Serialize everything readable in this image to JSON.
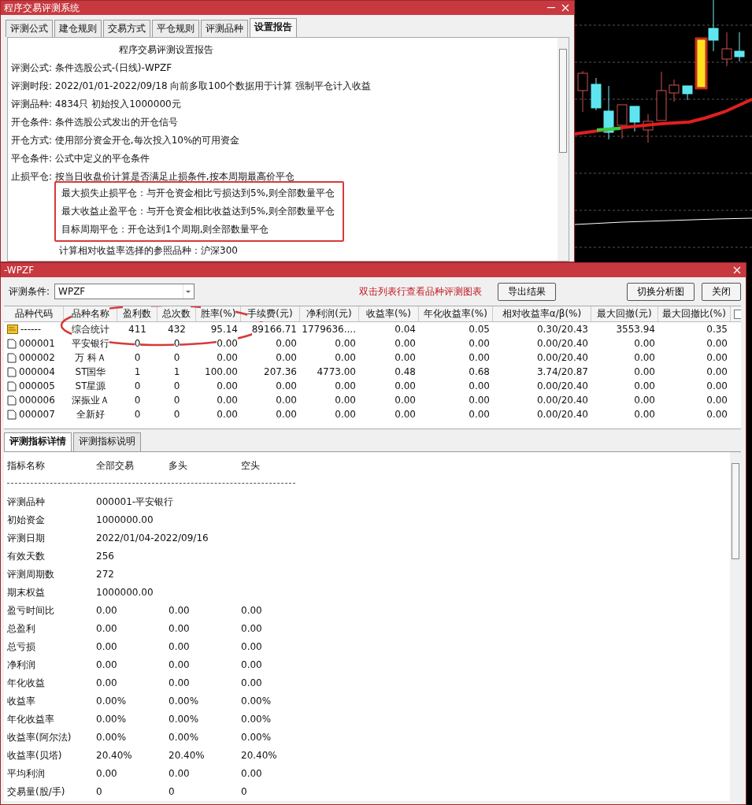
{
  "report_window": {
    "title": "程序交易评测系统",
    "tabs": [
      {
        "label": "评测公式",
        "selected": false
      },
      {
        "label": "建仓规则",
        "selected": false
      },
      {
        "label": "交易方式",
        "selected": false
      },
      {
        "label": "平仓规则",
        "selected": false
      },
      {
        "label": "评测品种",
        "selected": false
      },
      {
        "label": "设置报告",
        "selected": true
      }
    ],
    "report": {
      "title": "程序交易评测设置报告",
      "lines": [
        "评测公式: 条件选股公式-(日线)-WPZF",
        "评测时段: 2022/01/01-2022/09/18 向前多取100个数据用于计算 强制平仓计入收益",
        "评测品种: 4834只 初始投入1000000元",
        "开仓条件: 条件选股公式发出的开仓信号",
        "开仓方式: 使用部分资金开仓,每次投入10%的可用资金",
        "平仓条件: 公式中定义的平仓条件",
        "止损平仓: 按当日收盘价计算是否满足止损条件,按本周期最高价平仓"
      ],
      "highlighted_rules": [
        "最大损失止损平仓：与开仓资金相比亏损达到5%,则全部数量平仓",
        "最大收益止盈平仓：与开仓资金相比收益达到5%,则全部数量平仓",
        "目标周期平仓：开仓达到1个周期,则全部数量平仓"
      ],
      "reference": "计算相对收益率选择的参照品种：沪深300"
    }
  },
  "results_window": {
    "title": "-WPZF",
    "condition_label": "评测条件:",
    "condition_value": "WPZF",
    "hint": "双击列表行查看品种评测图表",
    "export_button": "导出结果",
    "buttons": [
      "切换分析图",
      "关闭"
    ],
    "table": {
      "columns": [
        "品种代码",
        "品种名称",
        "盈利数",
        "总次数",
        "胜率(%)",
        "手续费(元)",
        "净利润(元)",
        "收益率(%)",
        "年化收益率(%)",
        "相对收益率α/β(%)",
        "最大回撤(元)",
        "最大回撤比(%)"
      ],
      "rows": [
        {
          "kind": "summary",
          "cells": [
            "------",
            "综合统计",
            "411",
            "432",
            "95.14",
            "89166.71",
            "1779636....",
            "0.04",
            "0.05",
            "0.30/20.43",
            "3553.94",
            "0.35"
          ]
        },
        {
          "kind": "stock",
          "cells": [
            "000001",
            "平安银行",
            "0",
            "0",
            "0.00",
            "0.00",
            "0.00",
            "0.00",
            "0.00",
            "0.00/20.40",
            "0.00",
            "0.00"
          ]
        },
        {
          "kind": "stock",
          "cells": [
            "000002",
            "万 科Ａ",
            "0",
            "0",
            "0.00",
            "0.00",
            "0.00",
            "0.00",
            "0.00",
            "0.00/20.40",
            "0.00",
            "0.00"
          ]
        },
        {
          "kind": "stock",
          "cells": [
            "000004",
            "ST国华",
            "1",
            "1",
            "100.00",
            "207.36",
            "4773.00",
            "0.48",
            "0.68",
            "3.74/20.87",
            "0.00",
            "0.00"
          ]
        },
        {
          "kind": "stock",
          "cells": [
            "000005",
            "ST星源",
            "0",
            "0",
            "0.00",
            "0.00",
            "0.00",
            "0.00",
            "0.00",
            "0.00/20.40",
            "0.00",
            "0.00"
          ]
        },
        {
          "kind": "stock",
          "cells": [
            "000006",
            "深振业Ａ",
            "0",
            "0",
            "0.00",
            "0.00",
            "0.00",
            "0.00",
            "0.00",
            "0.00/20.40",
            "0.00",
            "0.00"
          ]
        },
        {
          "kind": "stock",
          "cells": [
            "000007",
            "全新好",
            "0",
            "0",
            "0.00",
            "0.00",
            "0.00",
            "0.00",
            "0.00",
            "0.00/20.40",
            "0.00",
            "0.00"
          ]
        }
      ]
    },
    "detail_tabs": [
      {
        "label": "评测指标详情",
        "selected": true
      },
      {
        "label": "评测指标说明",
        "selected": false
      }
    ],
    "detail": {
      "columns": [
        "指标名称",
        "全部交易",
        "多头",
        "空头"
      ],
      "rows": [
        {
          "name": "评测品种",
          "values": [
            "000001-平安银行"
          ]
        },
        {
          "name": "初始资金",
          "values": [
            "1000000.00"
          ]
        },
        {
          "name": "评测日期",
          "values": [
            "2022/01/04-2022/09/16"
          ]
        },
        {
          "name": "有效天数",
          "values": [
            "256"
          ]
        },
        {
          "name": "评测周期数",
          "values": [
            "272"
          ]
        },
        {
          "name": "期末权益",
          "values": [
            "1000000.00"
          ]
        },
        {
          "name": "盈亏时间比",
          "values": [
            "0.00",
            "0.00",
            "0.00"
          ]
        },
        {
          "name": "总盈利",
          "values": [
            "0.00",
            "0.00",
            "0.00"
          ]
        },
        {
          "name": "总亏损",
          "values": [
            "0.00",
            "0.00",
            "0.00"
          ]
        },
        {
          "name": "净利润",
          "values": [
            "0.00",
            "0.00",
            "0.00"
          ]
        },
        {
          "name": "年化收益",
          "values": [
            "0.00",
            "0.00",
            "0.00"
          ]
        },
        {
          "name": "收益率",
          "values": [
            "0.00%",
            "0.00%",
            "0.00%"
          ]
        },
        {
          "name": "年化收益率",
          "values": [
            "0.00%",
            "0.00%",
            "0.00%"
          ]
        },
        {
          "name": "收益率(阿尔法)",
          "values": [
            "0.00%",
            "0.00%",
            "0.00%"
          ]
        },
        {
          "name": "收益率(贝塔)",
          "values": [
            "20.40%",
            "20.40%",
            "20.40%"
          ]
        },
        {
          "name": "平均利润",
          "values": [
            "0.00",
            "0.00",
            "0.00"
          ]
        },
        {
          "name": "交易量(股/手)",
          "values": [
            "0",
            "0",
            "0"
          ]
        }
      ]
    }
  }
}
